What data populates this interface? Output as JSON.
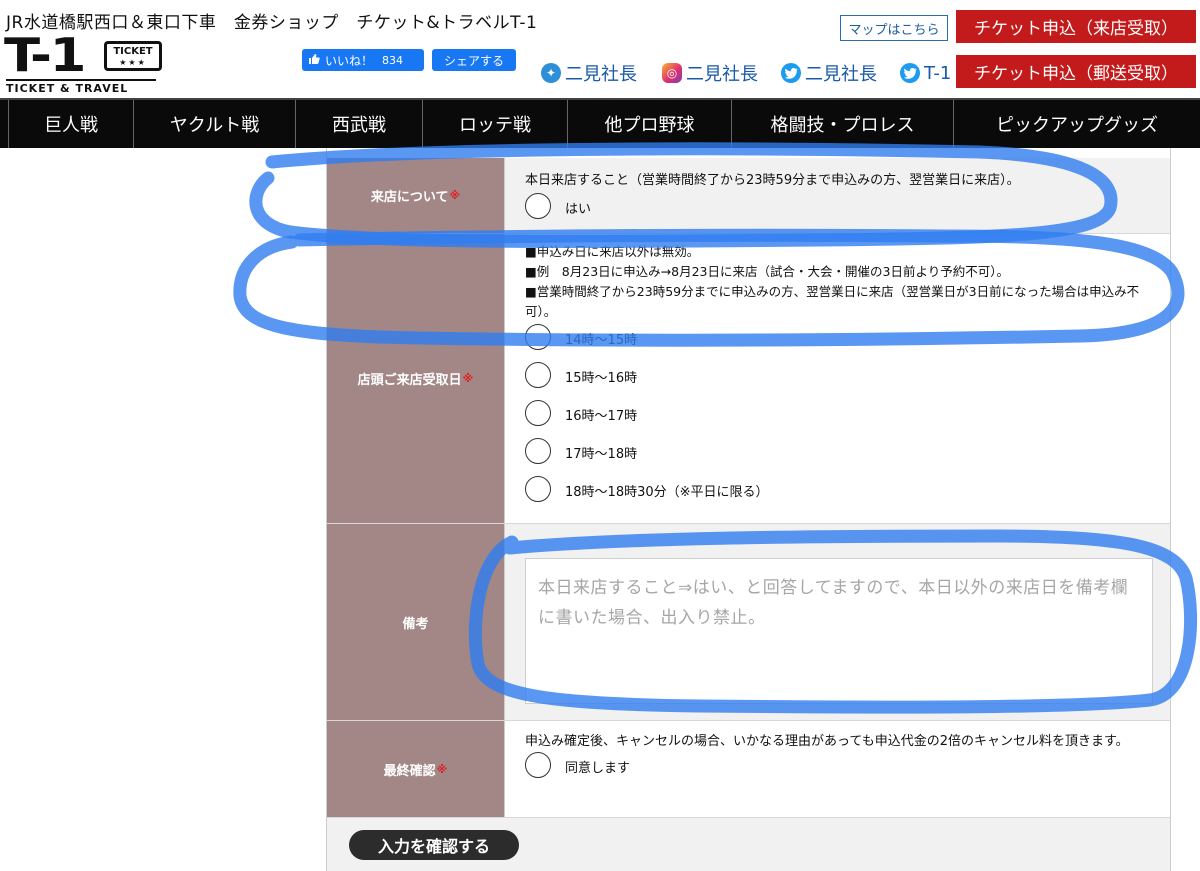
{
  "header": {
    "tagline": "JR水道橋駅西口＆東口下車　金券ショップ　チケット&トラベルT-1",
    "logo_main": "T-1",
    "logo_ticket": "TICKET",
    "logo_stars": "★★★",
    "logo_sub": "TICKET & TRAVEL",
    "fb_like_label": "いいね！",
    "fb_like_count": "834",
    "fb_share_label": "シェアする",
    "social": [
      {
        "icon": "ameba-icon",
        "label": "二見社長"
      },
      {
        "icon": "instagram-icon",
        "label": "二見社長"
      },
      {
        "icon": "twitter-icon",
        "label": "二見社長"
      },
      {
        "icon": "twitter-icon",
        "label": "T-1"
      }
    ],
    "map_button": "マップはこちら",
    "apply_store_button": "チケット申込（来店受取）",
    "apply_mail_button": "チケット申込（郵送受取）"
  },
  "nav": [
    "巨人戦",
    "ヤクルト戦",
    "西武戦",
    "ロッテ戦",
    "他プロ野球",
    "格闘技・プロレス",
    "ピックアップグッズ"
  ],
  "form": {
    "visit": {
      "label": "来店について",
      "required_mark": "※",
      "text": "本日来店すること（営業時間終了から23時59分まで申込みの方、翌営業日に来店）。",
      "option": "はい"
    },
    "pickup": {
      "label": "店頭ご来店受取日",
      "required_mark": "※",
      "notes": [
        "■申込み日に来店以外は無効。",
        "■例　8月23日に申込み→8月23日に来店（試合・大会・開催の3日前より予約不可）。",
        "■営業時間終了から23時59分までに申込みの方、翌営業日に来店（翌営業日が3日前になった場合は申込み不可）。"
      ],
      "options": [
        "14時〜15時",
        "15時〜16時",
        "16時〜17時",
        "17時〜18時",
        "18時〜18時30分（※平日に限る）"
      ]
    },
    "remarks": {
      "label": "備考",
      "placeholder": "本日来店すること⇒はい、と回答してますので、本日以外の来店日を備考欄に書いた場合、出入り禁止。"
    },
    "final": {
      "label": "最終確認",
      "required_mark": "※",
      "text": "申込み確定後、キャンセルの場合、いかなる理由があっても申込代金の2倍のキャンセル料を頂きます。",
      "option": "同意します"
    },
    "submit_button": "入力を確認する"
  },
  "colors": {
    "label_bg": "#a28786",
    "nav_bg": "#0a0a0a",
    "apply_button": "#c31b1b",
    "facebook": "#1877f2",
    "annotation_marker": "#2f7df0"
  }
}
